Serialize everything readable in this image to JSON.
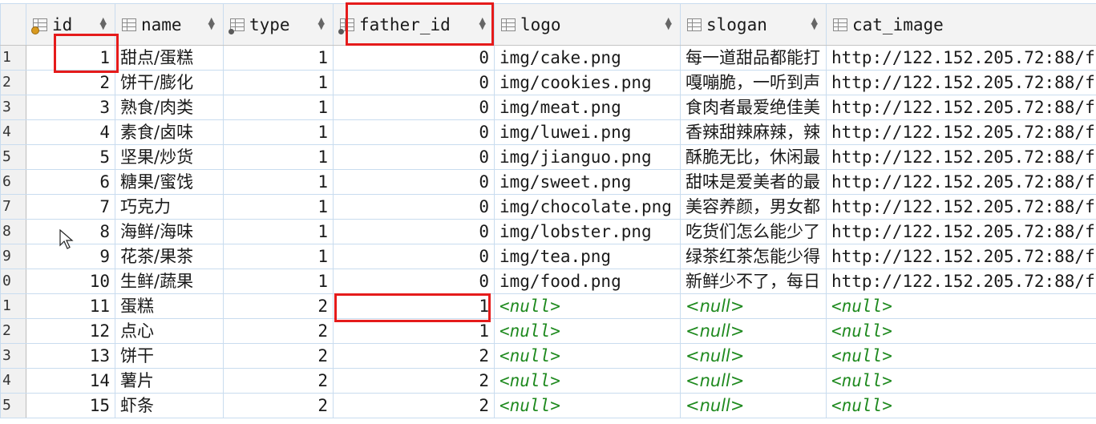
{
  "columns": [
    {
      "key": "id",
      "label": "id",
      "icon": "primary-key-icon"
    },
    {
      "key": "name",
      "label": "name",
      "icon": "column-icon"
    },
    {
      "key": "type",
      "label": "type",
      "icon": "foreign-key-icon"
    },
    {
      "key": "father_id",
      "label": "father_id",
      "icon": "column-icon"
    },
    {
      "key": "logo",
      "label": "logo",
      "icon": "column-icon"
    },
    {
      "key": "slogan",
      "label": "slogan",
      "icon": "column-icon"
    },
    {
      "key": "cat_image",
      "label": "cat_image",
      "icon": "column-icon"
    }
  ],
  "row_numbers": [
    "1",
    "2",
    "3",
    "4",
    "5",
    "6",
    "7",
    "8",
    "9",
    "0",
    "1",
    "2",
    "3",
    "4",
    "5"
  ],
  "rows": [
    {
      "id": "1",
      "name": "甜点/蛋糕",
      "type": "1",
      "father_id": "0",
      "logo": "img/cake.png",
      "slogan": "每一道甜品都能打",
      "cat_image": "http://122.152.205.72:88/f"
    },
    {
      "id": "2",
      "name": "饼干/膨化",
      "type": "1",
      "father_id": "0",
      "logo": "img/cookies.png",
      "slogan": "嘎嘣脆，一听到声",
      "cat_image": "http://122.152.205.72:88/f"
    },
    {
      "id": "3",
      "name": "熟食/肉类",
      "type": "1",
      "father_id": "0",
      "logo": "img/meat.png",
      "slogan": "食肉者最爱绝佳美",
      "cat_image": "http://122.152.205.72:88/f"
    },
    {
      "id": "4",
      "name": "素食/卤味",
      "type": "1",
      "father_id": "0",
      "logo": "img/luwei.png",
      "slogan": "香辣甜辣麻辣，辣",
      "cat_image": "http://122.152.205.72:88/f"
    },
    {
      "id": "5",
      "name": "坚果/炒货",
      "type": "1",
      "father_id": "0",
      "logo": "img/jianguo.png",
      "slogan": "酥脆无比，休闲最",
      "cat_image": "http://122.152.205.72:88/f"
    },
    {
      "id": "6",
      "name": "糖果/蜜饯",
      "type": "1",
      "father_id": "0",
      "logo": "img/sweet.png",
      "slogan": "甜味是爱美者的最",
      "cat_image": "http://122.152.205.72:88/f"
    },
    {
      "id": "7",
      "name": "巧克力",
      "type": "1",
      "father_id": "0",
      "logo": "img/chocolate.png",
      "slogan": "美容养颜，男女都",
      "cat_image": "http://122.152.205.72:88/f"
    },
    {
      "id": "8",
      "name": "海鲜/海味",
      "type": "1",
      "father_id": "0",
      "logo": "img/lobster.png",
      "slogan": "吃货们怎么能少了",
      "cat_image": "http://122.152.205.72:88/f"
    },
    {
      "id": "9",
      "name": "花茶/果茶",
      "type": "1",
      "father_id": "0",
      "logo": "img/tea.png",
      "slogan": "绿茶红茶怎能少得",
      "cat_image": "http://122.152.205.72:88/f"
    },
    {
      "id": "10",
      "name": "生鲜/蔬果",
      "type": "1",
      "father_id": "0",
      "logo": "img/food.png",
      "slogan": "新鲜少不了，每日",
      "cat_image": "http://122.152.205.72:88/f"
    },
    {
      "id": "11",
      "name": "蛋糕",
      "type": "2",
      "father_id": "1",
      "logo": "<null>",
      "slogan": "<null>",
      "cat_image": "<null>"
    },
    {
      "id": "12",
      "name": "点心",
      "type": "2",
      "father_id": "1",
      "logo": "<null>",
      "slogan": "<null>",
      "cat_image": "<null>"
    },
    {
      "id": "13",
      "name": "饼干",
      "type": "2",
      "father_id": "2",
      "logo": "<null>",
      "slogan": "<null>",
      "cat_image": "<null>"
    },
    {
      "id": "14",
      "name": "薯片",
      "type": "2",
      "father_id": "2",
      "logo": "<null>",
      "slogan": "<null>",
      "cat_image": "<null>"
    },
    {
      "id": "15",
      "name": "虾条",
      "type": "2",
      "father_id": "2",
      "logo": "<null>",
      "slogan": "<null>",
      "cat_image": "<null>"
    }
  ],
  "colors": {
    "highlight": "#e51b1b",
    "null_text": "#1f8a1f",
    "grid_line": "#c9dcef"
  }
}
